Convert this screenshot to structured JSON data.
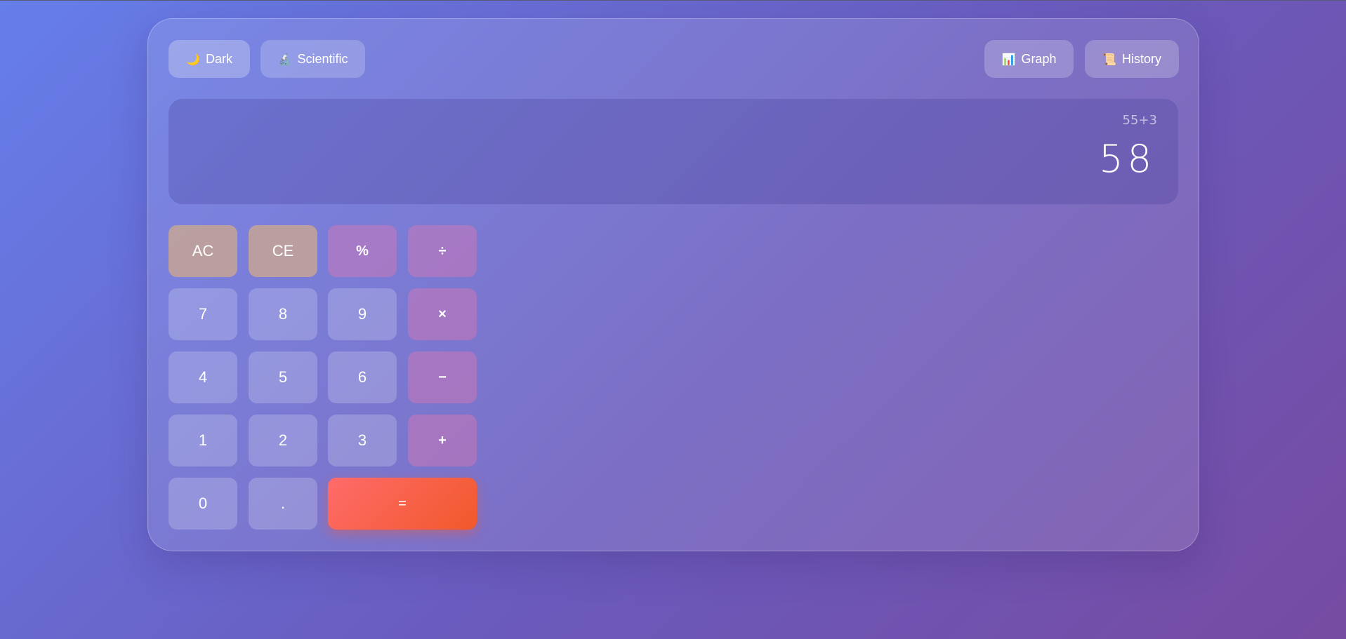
{
  "toolbar": {
    "dark": {
      "icon": "🌙",
      "label": "Dark"
    },
    "scientific": {
      "icon": "🔬",
      "label": "Scientific"
    },
    "graph": {
      "icon": "📊",
      "label": "Graph"
    },
    "history": {
      "icon": "📜",
      "label": "History"
    }
  },
  "display": {
    "expression": "55+3",
    "result": "58"
  },
  "keys": {
    "ac": "AC",
    "ce": "CE",
    "percent": "%",
    "divide": "÷",
    "seven": "7",
    "eight": "8",
    "nine": "9",
    "multiply": "×",
    "four": "4",
    "five": "5",
    "six": "6",
    "subtract": "−",
    "one": "1",
    "two": "2",
    "three": "3",
    "add": "+",
    "zero": "0",
    "decimal": ".",
    "equals": "="
  },
  "colors": {
    "background_start": "#667eea",
    "background_end": "#764ba2",
    "equals_start": "#ff6b6b",
    "equals_end": "#f1592a"
  }
}
